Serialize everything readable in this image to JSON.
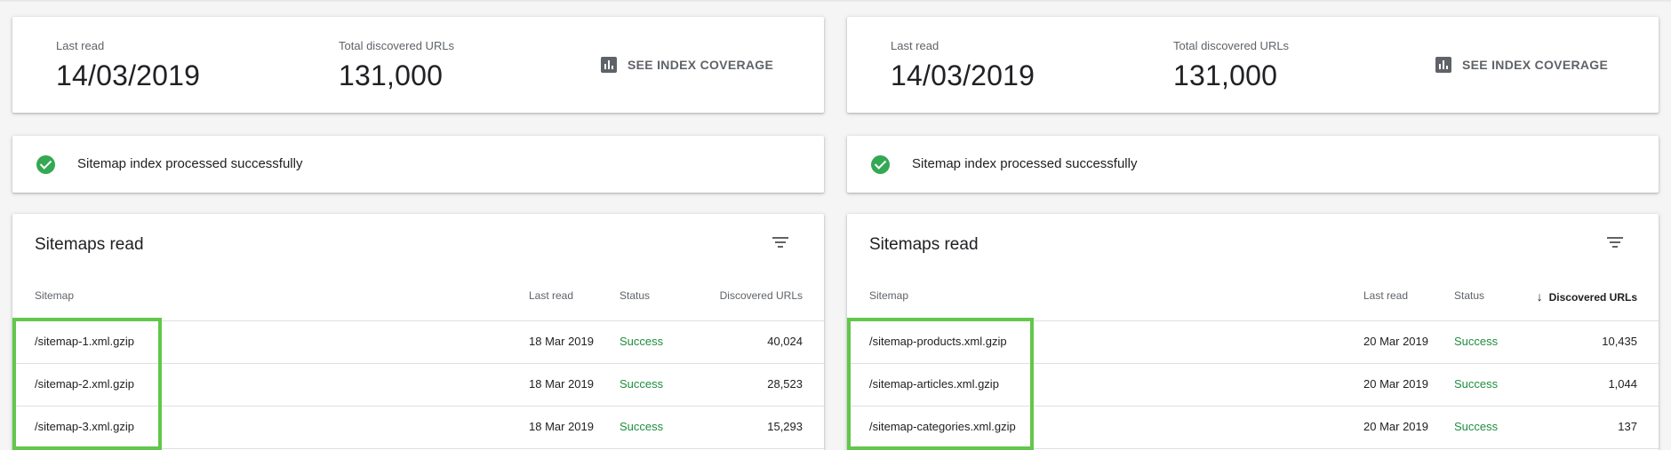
{
  "panels": [
    {
      "summary": {
        "last_read_label": "Last read",
        "last_read_value": "14/03/2019",
        "total_label": "Total discovered URLs",
        "total_value": "131,000",
        "coverage_link": "SEE INDEX COVERAGE"
      },
      "status_message": "Sitemap index processed successfully",
      "table": {
        "title": "Sitemaps read",
        "columns": [
          "Sitemap",
          "Last read",
          "Status",
          "Discovered URLs"
        ],
        "sorted_column": "",
        "rows": [
          {
            "sitemap": "/sitemap-1.xml.gzip",
            "last_read": "18 Mar 2019",
            "status": "Success",
            "urls": "40,024"
          },
          {
            "sitemap": "/sitemap-2.xml.gzip",
            "last_read": "18 Mar 2019",
            "status": "Success",
            "urls": "28,523"
          },
          {
            "sitemap": "/sitemap-3.xml.gzip",
            "last_read": "18 Mar 2019",
            "status": "Success",
            "urls": "15,293"
          }
        ]
      }
    },
    {
      "summary": {
        "last_read_label": "Last read",
        "last_read_value": "14/03/2019",
        "total_label": "Total discovered URLs",
        "total_value": "131,000",
        "coverage_link": "SEE INDEX COVERAGE"
      },
      "status_message": "Sitemap index processed successfully",
      "table": {
        "title": "Sitemaps read",
        "columns": [
          "Sitemap",
          "Last read",
          "Status",
          "Discovered URLs"
        ],
        "sorted_column": "Discovered URLs",
        "rows": [
          {
            "sitemap": "/sitemap-products.xml.gzip",
            "last_read": "20 Mar 2019",
            "status": "Success",
            "urls": "10,435"
          },
          {
            "sitemap": "/sitemap-articles.xml.gzip",
            "last_read": "20 Mar 2019",
            "status": "Success",
            "urls": "1,044"
          },
          {
            "sitemap": "/sitemap-categories.xml.gzip",
            "last_read": "20 Mar 2019",
            "status": "Success",
            "urls": "137"
          }
        ]
      }
    }
  ],
  "colors": {
    "success": "#1e8e3e",
    "check_icon": "#34a853",
    "highlight": "#62c74a"
  }
}
